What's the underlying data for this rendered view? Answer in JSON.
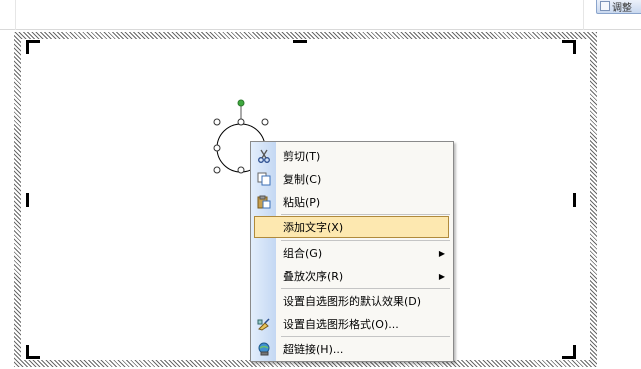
{
  "toolbar": {
    "button_label": "调整"
  },
  "context_menu": {
    "items": [
      {
        "label": "剪切(T)",
        "icon": "scissors-icon"
      },
      {
        "label": "复制(C)",
        "icon": "copy-icon"
      },
      {
        "label": "粘贴(P)",
        "icon": "paste-icon"
      },
      {
        "label": "添加文字(X)",
        "icon": "",
        "highlighted": true
      },
      {
        "label": "组合(G)",
        "icon": "",
        "submenu": true
      },
      {
        "label": "叠放次序(R)",
        "icon": "",
        "submenu": true
      },
      {
        "label": "设置自选图形的默认效果(D)",
        "icon": ""
      },
      {
        "label": "设置自选图形格式(O)...",
        "icon": "format-shape-icon"
      },
      {
        "label": "超链接(H)...",
        "icon": "hyperlink-icon"
      }
    ],
    "submenu_arrow": "▶"
  },
  "colors": {
    "highlight": "#fde8b0",
    "gutter": "#c4d8f3",
    "rotate_handle": "#3fa83f"
  }
}
